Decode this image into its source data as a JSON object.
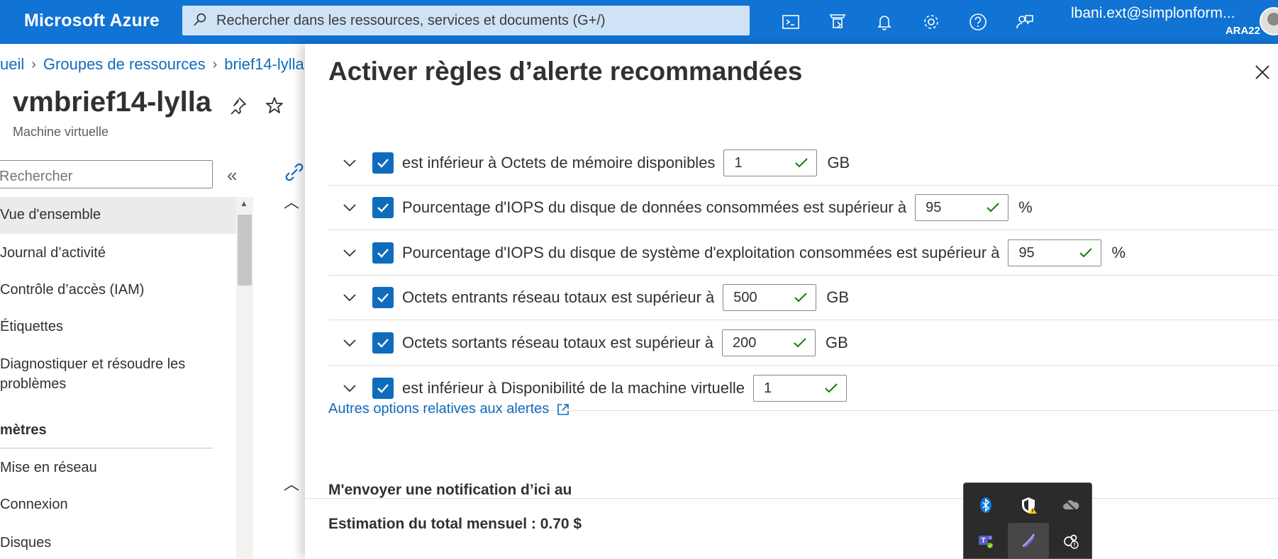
{
  "topbar": {
    "brand": "Microsoft Azure",
    "search_placeholder": "Rechercher dans les ressources, services et documents (G+/)",
    "icons": [
      "cloud-shell-icon",
      "directory-filter-icon",
      "notifications-icon",
      "settings-icon",
      "help-icon",
      "feedback-icon"
    ],
    "user_name": "lbani.ext@simplonform...",
    "user_org": "ARA22"
  },
  "breadcrumb": {
    "items": [
      "ueil",
      "Groupes de ressources",
      "brief14-lylla"
    ]
  },
  "resource": {
    "title": "vmbrief14-lylla",
    "subtitle": "Machine virtuelle"
  },
  "sidebar": {
    "search_placeholder": "Rechercher",
    "items": [
      {
        "label": "Vue d'ensemble",
        "active": true
      },
      {
        "label": "Journal d’activité"
      },
      {
        "label": "Contrôle d’accès (IAM)"
      },
      {
        "label": "Étiquettes"
      },
      {
        "label": "Diagnostiquer et résoudre les problèmes"
      }
    ],
    "section_title": "mètres",
    "section_items": [
      {
        "label": "Mise en réseau"
      },
      {
        "label": "Connexion"
      },
      {
        "label": "Disques"
      }
    ]
  },
  "panel": {
    "title": "Activer règles d’alerte recommandées",
    "rules": [
      {
        "text": "est inférieur à Octets de mémoire disponibles",
        "value": "1",
        "unit": "GB",
        "checked": true
      },
      {
        "text": "Pourcentage d'IOPS du disque de données consommées est supérieur à",
        "value": "95",
        "unit": "%",
        "checked": true
      },
      {
        "text": "Pourcentage d'IOPS du disque de système d'exploitation consommées est supérieur à",
        "value": "95",
        "unit": "%",
        "checked": true
      },
      {
        "text": "Octets entrants réseau totaux est supérieur à",
        "value": "500",
        "unit": "GB",
        "checked": true
      },
      {
        "text": "Octets sortants réseau totaux est supérieur à",
        "value": "200",
        "unit": "GB",
        "checked": true
      },
      {
        "text": "est inférieur à Disponibilité de la machine virtuelle",
        "value": "1",
        "unit": "",
        "checked": true
      }
    ],
    "more_options_link": "Autres options relatives aux alertes",
    "notify_label": "M'envoyer une notification d’ici au",
    "estimate": "Estimation du total mensuel : 0.70 $"
  },
  "tray": {
    "icons": [
      "bluetooth-icon",
      "security-warning-icon",
      "onedrive-offline-icon",
      "teams-icon",
      "pen-icon",
      "steam-icon"
    ]
  },
  "colors": {
    "topbar": "#1173d3",
    "accent": "#0f6cbd",
    "check_green": "#107c10"
  }
}
